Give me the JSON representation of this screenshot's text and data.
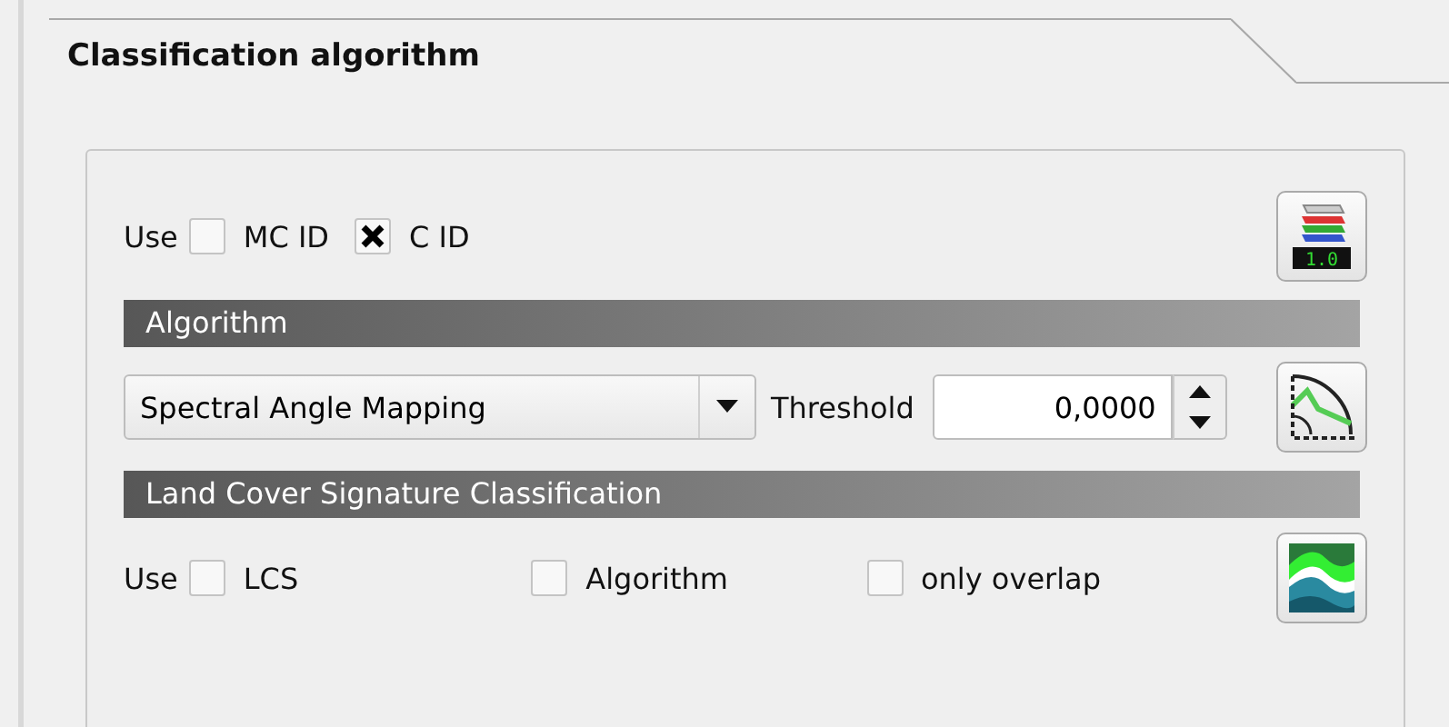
{
  "tab": {
    "title": "Classification algorithm"
  },
  "id_row": {
    "label": "Use",
    "options": [
      {
        "label": "MC ID",
        "checked": false
      },
      {
        "label": "C ID",
        "checked": true
      }
    ],
    "button_icon_text": "1.0"
  },
  "algorithm_section": {
    "title": "Algorithm",
    "combo": {
      "value": "Spectral Angle Mapping"
    },
    "threshold_label": "Threshold",
    "threshold": {
      "value": "0,0000"
    }
  },
  "lcs_section": {
    "title": "Land Cover Signature Classification",
    "label": "Use",
    "options": [
      {
        "label": "LCS",
        "checked": false
      },
      {
        "label": "Algorithm",
        "checked": false
      },
      {
        "label": "only overlap",
        "checked": false
      }
    ]
  }
}
